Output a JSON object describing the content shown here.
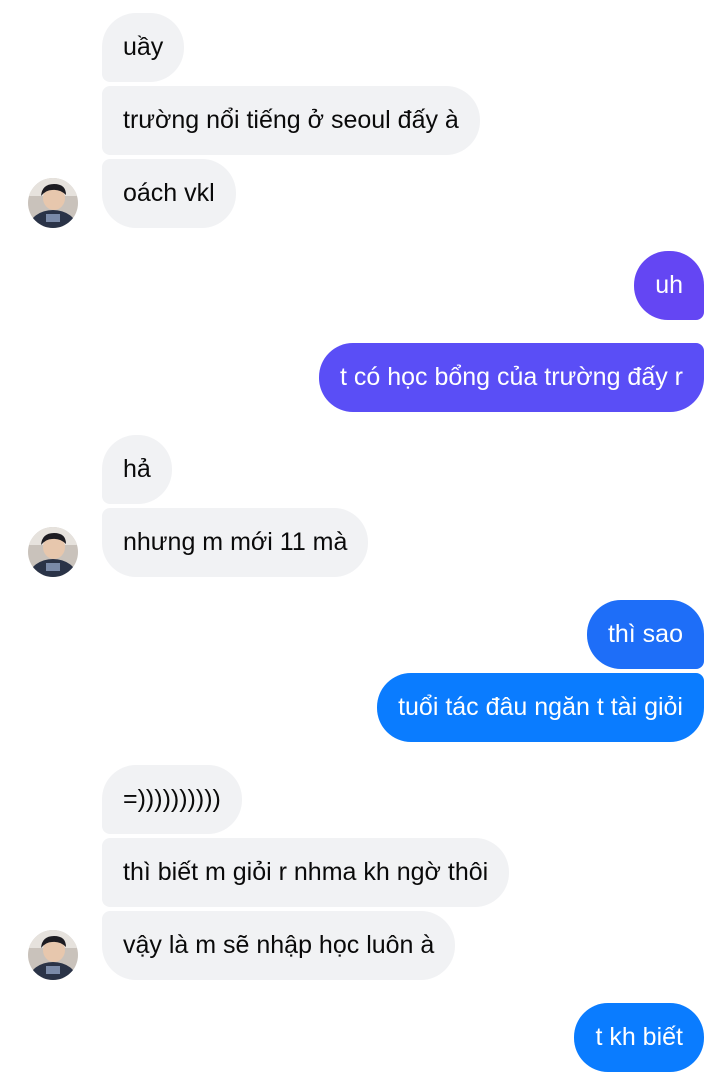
{
  "colors": {
    "received_bubble": "#f1f2f4",
    "received_text": "#0a0a0a",
    "sent_purple": "#6446f3",
    "sent_violet": "#5a4ef6",
    "sent_blue_mid": "#1e6ef8",
    "sent_blue": "#0a7cff"
  },
  "messages": [
    {
      "from": "other",
      "text": "uầy"
    },
    {
      "from": "other",
      "text": "trường nổi tiếng ở seoul đấy à"
    },
    {
      "from": "other",
      "text": "oách vkl"
    },
    {
      "from": "me",
      "text": "uh"
    },
    {
      "from": "me",
      "text": "t có học bổng của trường đấy r"
    },
    {
      "from": "other",
      "text": "hả"
    },
    {
      "from": "other",
      "text": "nhưng m mới 11 mà"
    },
    {
      "from": "me",
      "text": "thì sao"
    },
    {
      "from": "me",
      "text": "tuổi tác đâu ngăn t tài giỏi"
    },
    {
      "from": "other",
      "text": "=))))))))))"
    },
    {
      "from": "other",
      "text": "thì biết m giỏi r nhma kh ngờ thôi"
    },
    {
      "from": "other",
      "text": "vậy là m sẽ nhập học luôn à"
    },
    {
      "from": "me",
      "text": "t kh biết"
    }
  ],
  "avatar": {
    "icon": "contact-avatar-photo"
  }
}
